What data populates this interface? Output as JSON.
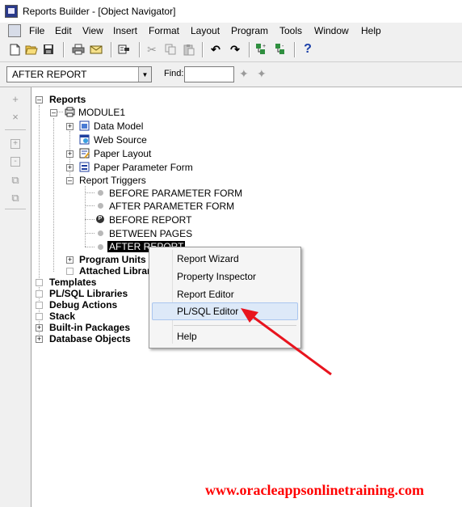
{
  "window": {
    "title": "Reports Builder - [Object Navigator]"
  },
  "menu": [
    "File",
    "Edit",
    "View",
    "Insert",
    "Format",
    "Layout",
    "Program",
    "Tools",
    "Window",
    "Help"
  ],
  "toolbar": {
    "icons": [
      "new-icon",
      "open-icon",
      "save-icon",
      "print-icon",
      "mail-icon",
      "run-icon",
      "cut-icon",
      "copy-icon",
      "paste-icon",
      "undo-icon",
      "redo-icon",
      "expand-all-icon",
      "collapse-all-icon",
      "help-icon"
    ],
    "help_glyph": "?"
  },
  "findbar": {
    "selected_object": "AFTER REPORT",
    "find_label": "Find:",
    "find_value": ""
  },
  "tree": {
    "root": "Reports",
    "module": "MODULE1",
    "module_children": [
      "Data Model",
      "Web Source",
      "Paper Layout",
      "Paper Parameter Form"
    ],
    "report_triggers": "Report Triggers",
    "triggers": [
      "BEFORE PARAMETER FORM",
      "AFTER PARAMETER FORM",
      "BEFORE REPORT",
      "BETWEEN PAGES",
      "AFTER REPORT"
    ],
    "program_units": "Program Units",
    "attached_libraries": "Attached Librar",
    "top_level": [
      "Templates",
      "PL/SQL Libraries",
      "Debug Actions",
      "Stack",
      "Built-in Packages",
      "Database Objects"
    ]
  },
  "context_menu": {
    "items": [
      "Report Wizard",
      "Property Inspector",
      "Report Editor",
      "PL/SQL Editor",
      "Help"
    ],
    "highlighted": "PL/SQL Editor"
  },
  "annotation": {
    "arrow_color": "#e8141e"
  },
  "watermark": "www.oracleappsonlinetraining.com"
}
